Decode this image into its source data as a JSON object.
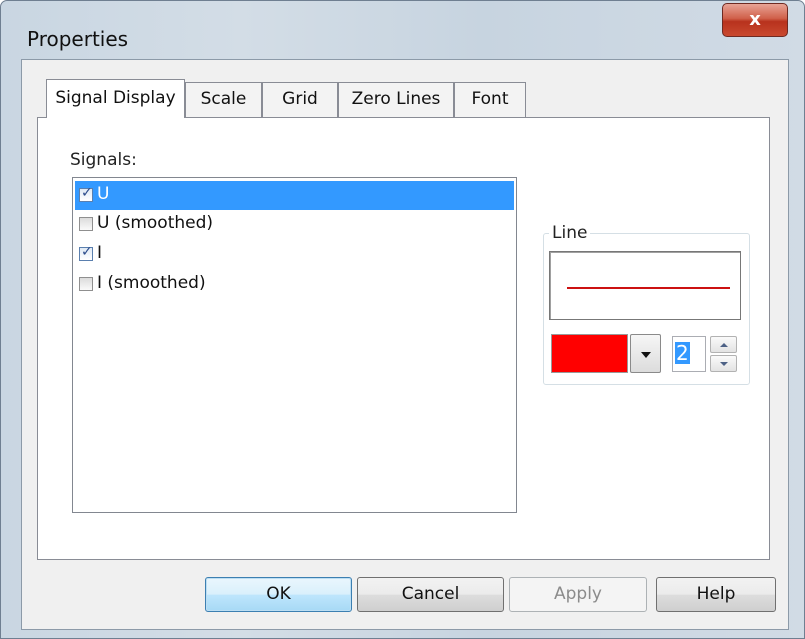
{
  "window": {
    "title": "Properties",
    "close_label": "x"
  },
  "tabs": [
    {
      "label": "Signal Display",
      "active": true
    },
    {
      "label": "Scale",
      "active": false
    },
    {
      "label": "Grid",
      "active": false
    },
    {
      "label": "Zero Lines",
      "active": false
    },
    {
      "label": "Font",
      "active": false
    }
  ],
  "signals": {
    "label": "Signals:",
    "items": [
      {
        "label": "U",
        "checked": true,
        "selected": true
      },
      {
        "label": "U (smoothed)",
        "checked": false,
        "selected": false
      },
      {
        "label": "I",
        "checked": true,
        "selected": false
      },
      {
        "label": "I (smoothed)",
        "checked": false,
        "selected": false
      }
    ]
  },
  "line": {
    "label": "Line",
    "color": "#ff0000",
    "preview_color": "#cc1111",
    "width": "2"
  },
  "buttons": {
    "ok": "OK",
    "cancel": "Cancel",
    "apply": "Apply",
    "help": "Help"
  }
}
